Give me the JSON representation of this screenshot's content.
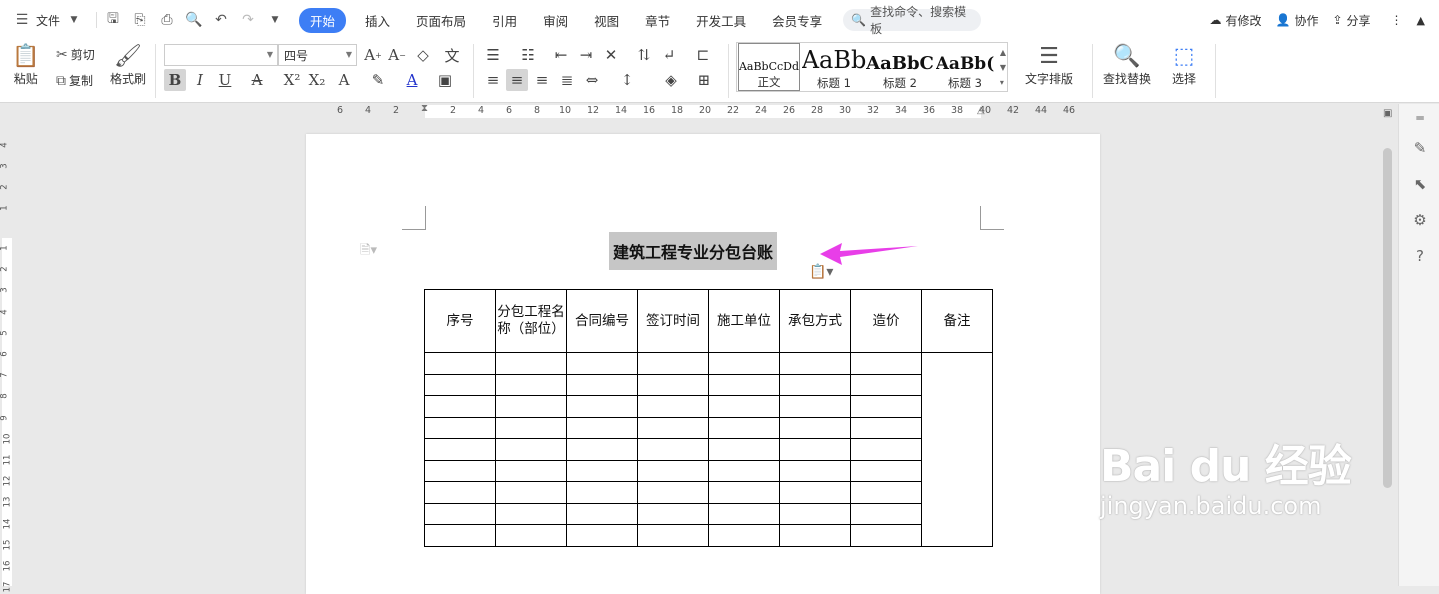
{
  "menubar": {
    "file_label": "文件",
    "tabs": [
      "开始",
      "插入",
      "页面布局",
      "引用",
      "审阅",
      "视图",
      "章节",
      "开发工具",
      "会员专享"
    ],
    "search_placeholder": "查找命令、搜索模板",
    "right": {
      "modified": "有修改",
      "collab": "协作",
      "share": "分享"
    }
  },
  "ribbon": {
    "paste": "粘贴",
    "cut": "剪切",
    "copy": "复制",
    "format_painter": "格式刷",
    "font_name": "",
    "font_size": "四号",
    "text_layout": "文字排版",
    "find_replace": "查找替换",
    "select": "选择",
    "styles": [
      {
        "preview": "AaBbCcDd",
        "label": "正文"
      },
      {
        "preview": "AaBb",
        "label": "标题 1"
      },
      {
        "preview": "AaBbC",
        "label": "标题 2"
      },
      {
        "preview": "AaBb(",
        "label": "标题 3"
      }
    ]
  },
  "ruler": {
    "h_left": [
      "6",
      "4",
      "2"
    ],
    "h_right": [
      "2",
      "4",
      "6",
      "8",
      "10",
      "12",
      "14",
      "16",
      "18",
      "20",
      "22",
      "24",
      "26",
      "28",
      "30",
      "32",
      "34",
      "36",
      "38",
      "40",
      "42",
      "44",
      "46"
    ],
    "v_top": [
      "4",
      "3",
      "2",
      "1"
    ],
    "v_main": [
      "1",
      "2",
      "3",
      "4",
      "5",
      "6",
      "7",
      "8",
      "9",
      "10",
      "11",
      "12",
      "13",
      "14",
      "15",
      "16",
      "17"
    ]
  },
  "document": {
    "title": "建筑工程专业分包台账",
    "headers": [
      "序号",
      "分包工程名称（部位）",
      "合同编号",
      "签订时间",
      "施工单位",
      "承包方式",
      "造价",
      "备注"
    ],
    "empty_rows": 9
  },
  "watermark": {
    "brand": "Bai du 经验",
    "url": "jingyan.baidu.com"
  },
  "colors": {
    "accent": "#3d7ef5",
    "arrow": "#e83ee8",
    "selection": "#c6c6c6"
  }
}
